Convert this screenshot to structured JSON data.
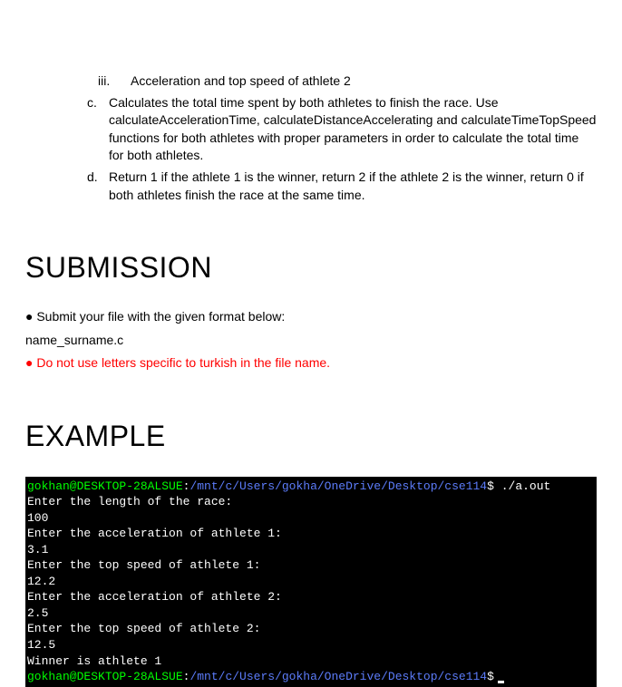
{
  "list": {
    "roman": {
      "marker": "iii.",
      "text": "Acceleration and top speed of athlete 2"
    },
    "alpha_c": {
      "marker": "c.",
      "text": "Calculates the total time spent by both athletes to finish the race. Use calculateAccelerationTime, calculateDistanceAccelerating and calculateTimeTopSpeed functions for both athletes with proper parameters in order to calculate the total time for both athletes."
    },
    "alpha_d": {
      "marker": "d.",
      "text": "Return 1 if the athlete 1 is the winner, return 2 if the athlete 2 is the winner, return 0 if both athletes finish the race at the same time."
    }
  },
  "submission": {
    "heading": "SUBMISSION",
    "bullet": "● Submit your file with the given format below:",
    "filename": "name_surname.c",
    "warning": "● Do not use letters specific to turkish in the file name."
  },
  "example": {
    "heading": "EXAMPLE"
  },
  "terminal": {
    "prompt1_user": "gokhan@DESKTOP-28ALSUE",
    "prompt1_colon": ":",
    "prompt1_path": "/mnt/c/Users/gokha/OneDrive/Desktop/cse114",
    "prompt1_dollar": "$",
    "prompt1_cmd": " ./a.out",
    "line1": "Enter the length of the race:",
    "line2": "100",
    "line3": "Enter the acceleration of athlete 1:",
    "line4": "3.1",
    "line5": "Enter the top speed of athlete 1:",
    "line6": "12.2",
    "line7": "Enter the acceleration of athlete 2:",
    "line8": "2.5",
    "line9": "Enter the top speed of athlete 2:",
    "line10": "12.5",
    "line11": "Winner is athlete 1",
    "prompt2_user": "gokhan@DESKTOP-28ALSUE",
    "prompt2_colon": ":",
    "prompt2_path": "/mnt/c/Users/gokha/OneDrive/Desktop/cse114",
    "prompt2_dollar": "$"
  }
}
